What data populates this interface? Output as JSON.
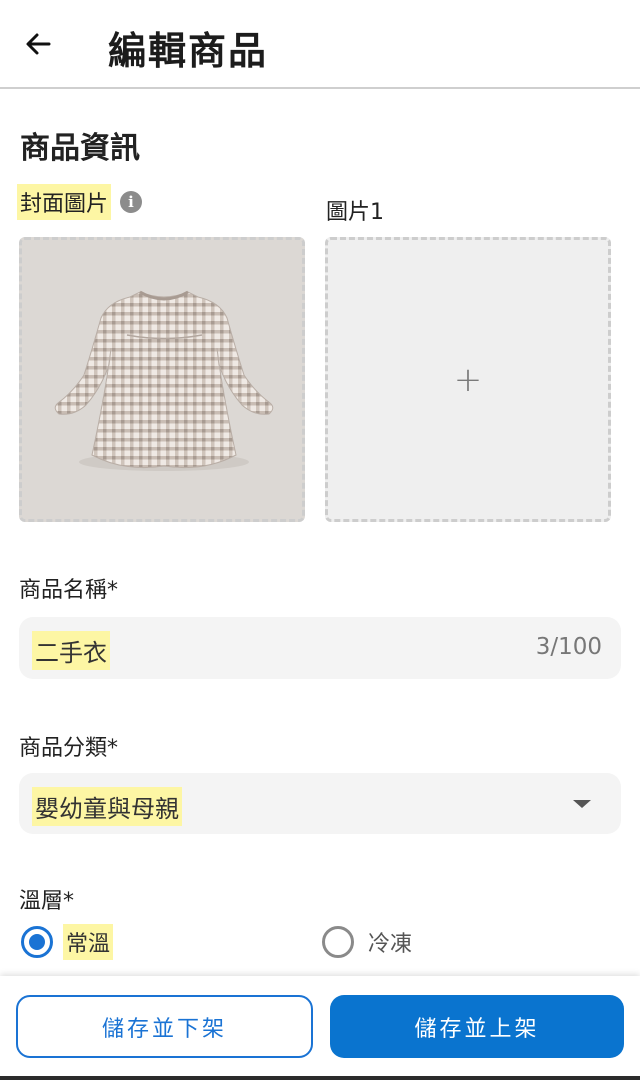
{
  "header": {
    "title": "編輯商品",
    "back_icon": "arrow-left-icon"
  },
  "section": {
    "title": "商品資訊"
  },
  "images": {
    "cover_label": "封面圖片",
    "cover_info_icon": "info-icon",
    "cover_info_glyph": "i",
    "image1_label": "圖片1",
    "add_icon": "plus-icon",
    "add_glyph": "+"
  },
  "name_field": {
    "label": "商品名稱*",
    "value": "二手衣",
    "counter": "3/100"
  },
  "category_field": {
    "label": "商品分類*",
    "value": "嬰幼童與母親",
    "dropdown_icon": "caret-down-icon"
  },
  "temperature": {
    "label": "溫層*",
    "options": [
      {
        "label": "常溫",
        "selected": true
      },
      {
        "label": "冷凍",
        "selected": false
      }
    ]
  },
  "footer": {
    "secondary_label": "儲存並下架",
    "primary_label": "儲存並上架"
  },
  "colors": {
    "accent": "#1a73d4",
    "primary_button": "#0a74cf",
    "highlight": "#fdf6a4",
    "field_bg": "#f4f4f4"
  }
}
